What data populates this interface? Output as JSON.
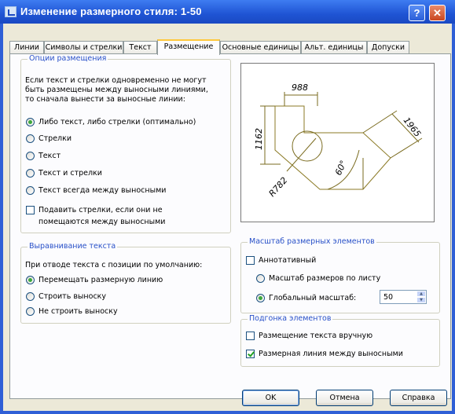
{
  "window": {
    "title": "Изменение размерного стиля: 1-50"
  },
  "tabs": [
    "Линии",
    "Символы и стрелки",
    "Текст",
    "Размещение",
    "Основные единицы",
    "Альт. единицы",
    "Допуски"
  ],
  "fit_options": {
    "legend": "Опции размещения",
    "description": [
      "Если текст и стрелки одновременно не могут",
      "быть размещены между выносными линиями,",
      "то сначала вынести за выносные линии:"
    ],
    "radios": [
      "Либо текст, либо стрелки (оптимально)",
      "Стрелки",
      "Текст",
      "Текст и стрелки",
      "Текст всегда между выносными"
    ],
    "suppress_line1": "Подавить стрелки, если они не",
    "suppress_line2": "помещаются между выносными"
  },
  "text_placement": {
    "legend": "Выравнивание текста",
    "subtitle": "При отводе текста с позиции по умолчанию:",
    "radios": [
      "Перемещать размерную линию",
      "Строить выноску",
      "Не строить выноску"
    ]
  },
  "preview": {
    "dim_top": "988",
    "dim_left": "1162",
    "dim_right": "1965",
    "angle": "60°",
    "radius": "R782"
  },
  "scale": {
    "legend": "Масштаб размерных элементов",
    "annotative": "Аннотативный",
    "to_layout": "Масштаб размеров по листу",
    "global": "Глобальный масштаб:",
    "global_value": "50"
  },
  "fine_tuning": {
    "legend": "Подгонка элементов",
    "manual": "Размещение текста вручную",
    "dim_line": "Размерная линия между выносными"
  },
  "buttons": {
    "ok": "OK",
    "cancel": "Отмена",
    "help": "Справка"
  },
  "colors": {
    "title_bar": "#1f54d4",
    "legend_text": "#2850c8",
    "preview_lines": "#7a6b1f",
    "active_tab_highlight": "#ffc83c"
  }
}
